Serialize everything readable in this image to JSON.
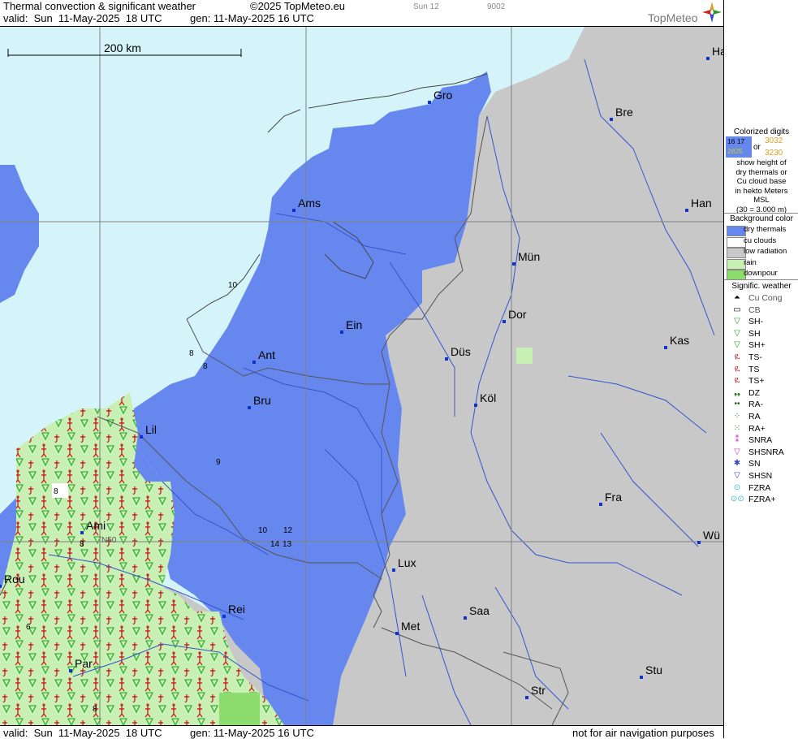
{
  "header": {
    "title": "Thermal convection & significant weather",
    "copyright": "©2025 TopMeteo.eu",
    "day": "Sun 12",
    "code": "9002",
    "valid": "valid:  Sun  11-May-2025  18 UTC",
    "generated": "gen: 11-May-2025 16 UTC",
    "logo_text": "TopMeteo"
  },
  "footer": {
    "valid": "valid:  Sun  11-May-2025  18 UTC",
    "generated": "gen: 11-May-2025 16 UTC",
    "note": "not for air navigation purposes"
  },
  "map": {
    "scale_label": "200 km",
    "cities": [
      {
        "name": "Ha"
      },
      {
        "name": "Gro"
      },
      {
        "name": "Bre"
      },
      {
        "name": "Ams"
      },
      {
        "name": "Han"
      },
      {
        "name": "Mün"
      },
      {
        "name": "Dor"
      },
      {
        "name": "Ein"
      },
      {
        "name": "Ant"
      },
      {
        "name": "Düs"
      },
      {
        "name": "Kas"
      },
      {
        "name": "Bru"
      },
      {
        "name": "Köl"
      },
      {
        "name": "Lil"
      },
      {
        "name": "Fra"
      },
      {
        "name": "Ami"
      },
      {
        "name": "Wü"
      },
      {
        "name": "Lux"
      },
      {
        "name": "Rei"
      },
      {
        "name": "Saa"
      },
      {
        "name": "Met"
      },
      {
        "name": "Par"
      },
      {
        "name": "Stu"
      },
      {
        "name": "Str"
      },
      {
        "name": "Rou"
      }
    ],
    "values": [
      "10",
      "8",
      "8",
      "9",
      "10",
      "12",
      "14",
      "13",
      "8",
      "8",
      "8",
      "6",
      "N50"
    ]
  },
  "legend": {
    "colorized_title": "Colorized digits",
    "sample_a": "16 17",
    "sample_b": "2825",
    "or": "or",
    "sample_c": "3032",
    "sample_d": "3230",
    "desc": [
      "show height of",
      "dry thermals or",
      "Cu cloud base",
      "in hekto Meters",
      "MSL",
      "(30 = 3.000 m)"
    ],
    "background_title": "Background color",
    "backgrounds": [
      {
        "label": "dry thermals",
        "color": "#6688ee"
      },
      {
        "label": "cu clouds",
        "color": "#ffffff"
      },
      {
        "label": "low radiation",
        "color": "#c8c8c8"
      },
      {
        "label": "rain",
        "color": "#c8f0b4"
      },
      {
        "label": "downpour",
        "color": "#8cdc6e"
      }
    ],
    "weather_title": "Signific. weather",
    "weather": [
      {
        "label": "Cu Cong",
        "icon": "cu-cong-icon",
        "glyph": "⏶",
        "color": "#000000"
      },
      {
        "label": "CB",
        "icon": "cb-icon",
        "glyph": "▭",
        "color": "#000000"
      },
      {
        "label": "SH-",
        "icon": "shower-light-icon",
        "glyph": "▽",
        "color": "#1a9e1a"
      },
      {
        "label": "SH",
        "icon": "shower-icon",
        "glyph": "▽",
        "color": "#1a9e1a"
      },
      {
        "label": "SH+",
        "icon": "shower-heavy-icon",
        "glyph": "▽",
        "color": "#1a9e1a"
      },
      {
        "label": "TS-",
        "icon": "thunderstorm-light-icon",
        "glyph": "ዪ",
        "color": "#cc2222"
      },
      {
        "label": "TS",
        "icon": "thunderstorm-icon",
        "glyph": "ዪ",
        "color": "#cc2222"
      },
      {
        "label": "TS+",
        "icon": "thunderstorm-heavy-icon",
        "glyph": "ዪ",
        "color": "#cc2222"
      },
      {
        "label": "DZ",
        "icon": "drizzle-icon",
        "glyph": "❟❟",
        "color": "#116611"
      },
      {
        "label": "RA-",
        "icon": "rain-light-icon",
        "glyph": "••",
        "color": "#116611"
      },
      {
        "label": "RA",
        "icon": "rain-icon",
        "glyph": "⁘",
        "color": "#116611"
      },
      {
        "label": "RA+",
        "icon": "rain-heavy-icon",
        "glyph": "⁙",
        "color": "#116611"
      },
      {
        "label": "SNRA",
        "icon": "snow-rain-icon",
        "glyph": "⁑",
        "color": "#bb33bb"
      },
      {
        "label": "SHSNRA",
        "icon": "snow-rain-shower-icon",
        "glyph": "▽",
        "color": "#bb33bb"
      },
      {
        "label": "SN",
        "icon": "snow-icon",
        "glyph": "✱",
        "color": "#3344cc"
      },
      {
        "label": "SHSN",
        "icon": "snow-shower-icon",
        "glyph": "▽",
        "color": "#3344cc"
      },
      {
        "label": "FZRA",
        "icon": "freezing-rain-icon",
        "glyph": "⊙",
        "color": "#33bbcc"
      },
      {
        "label": "FZRA+",
        "icon": "freezing-rain-heavy-icon",
        "glyph": "⊙⊙",
        "color": "#33bbcc"
      }
    ]
  },
  "colors": {
    "sea": "#d4f4fa",
    "dry_thermals": "#6688ee",
    "low_radiation": "#c8c8c8",
    "rain": "#c8f0b4",
    "downpour": "#8cdc6e",
    "rivers": "#3355cc",
    "borders": "#555555",
    "grid": "#808080"
  }
}
